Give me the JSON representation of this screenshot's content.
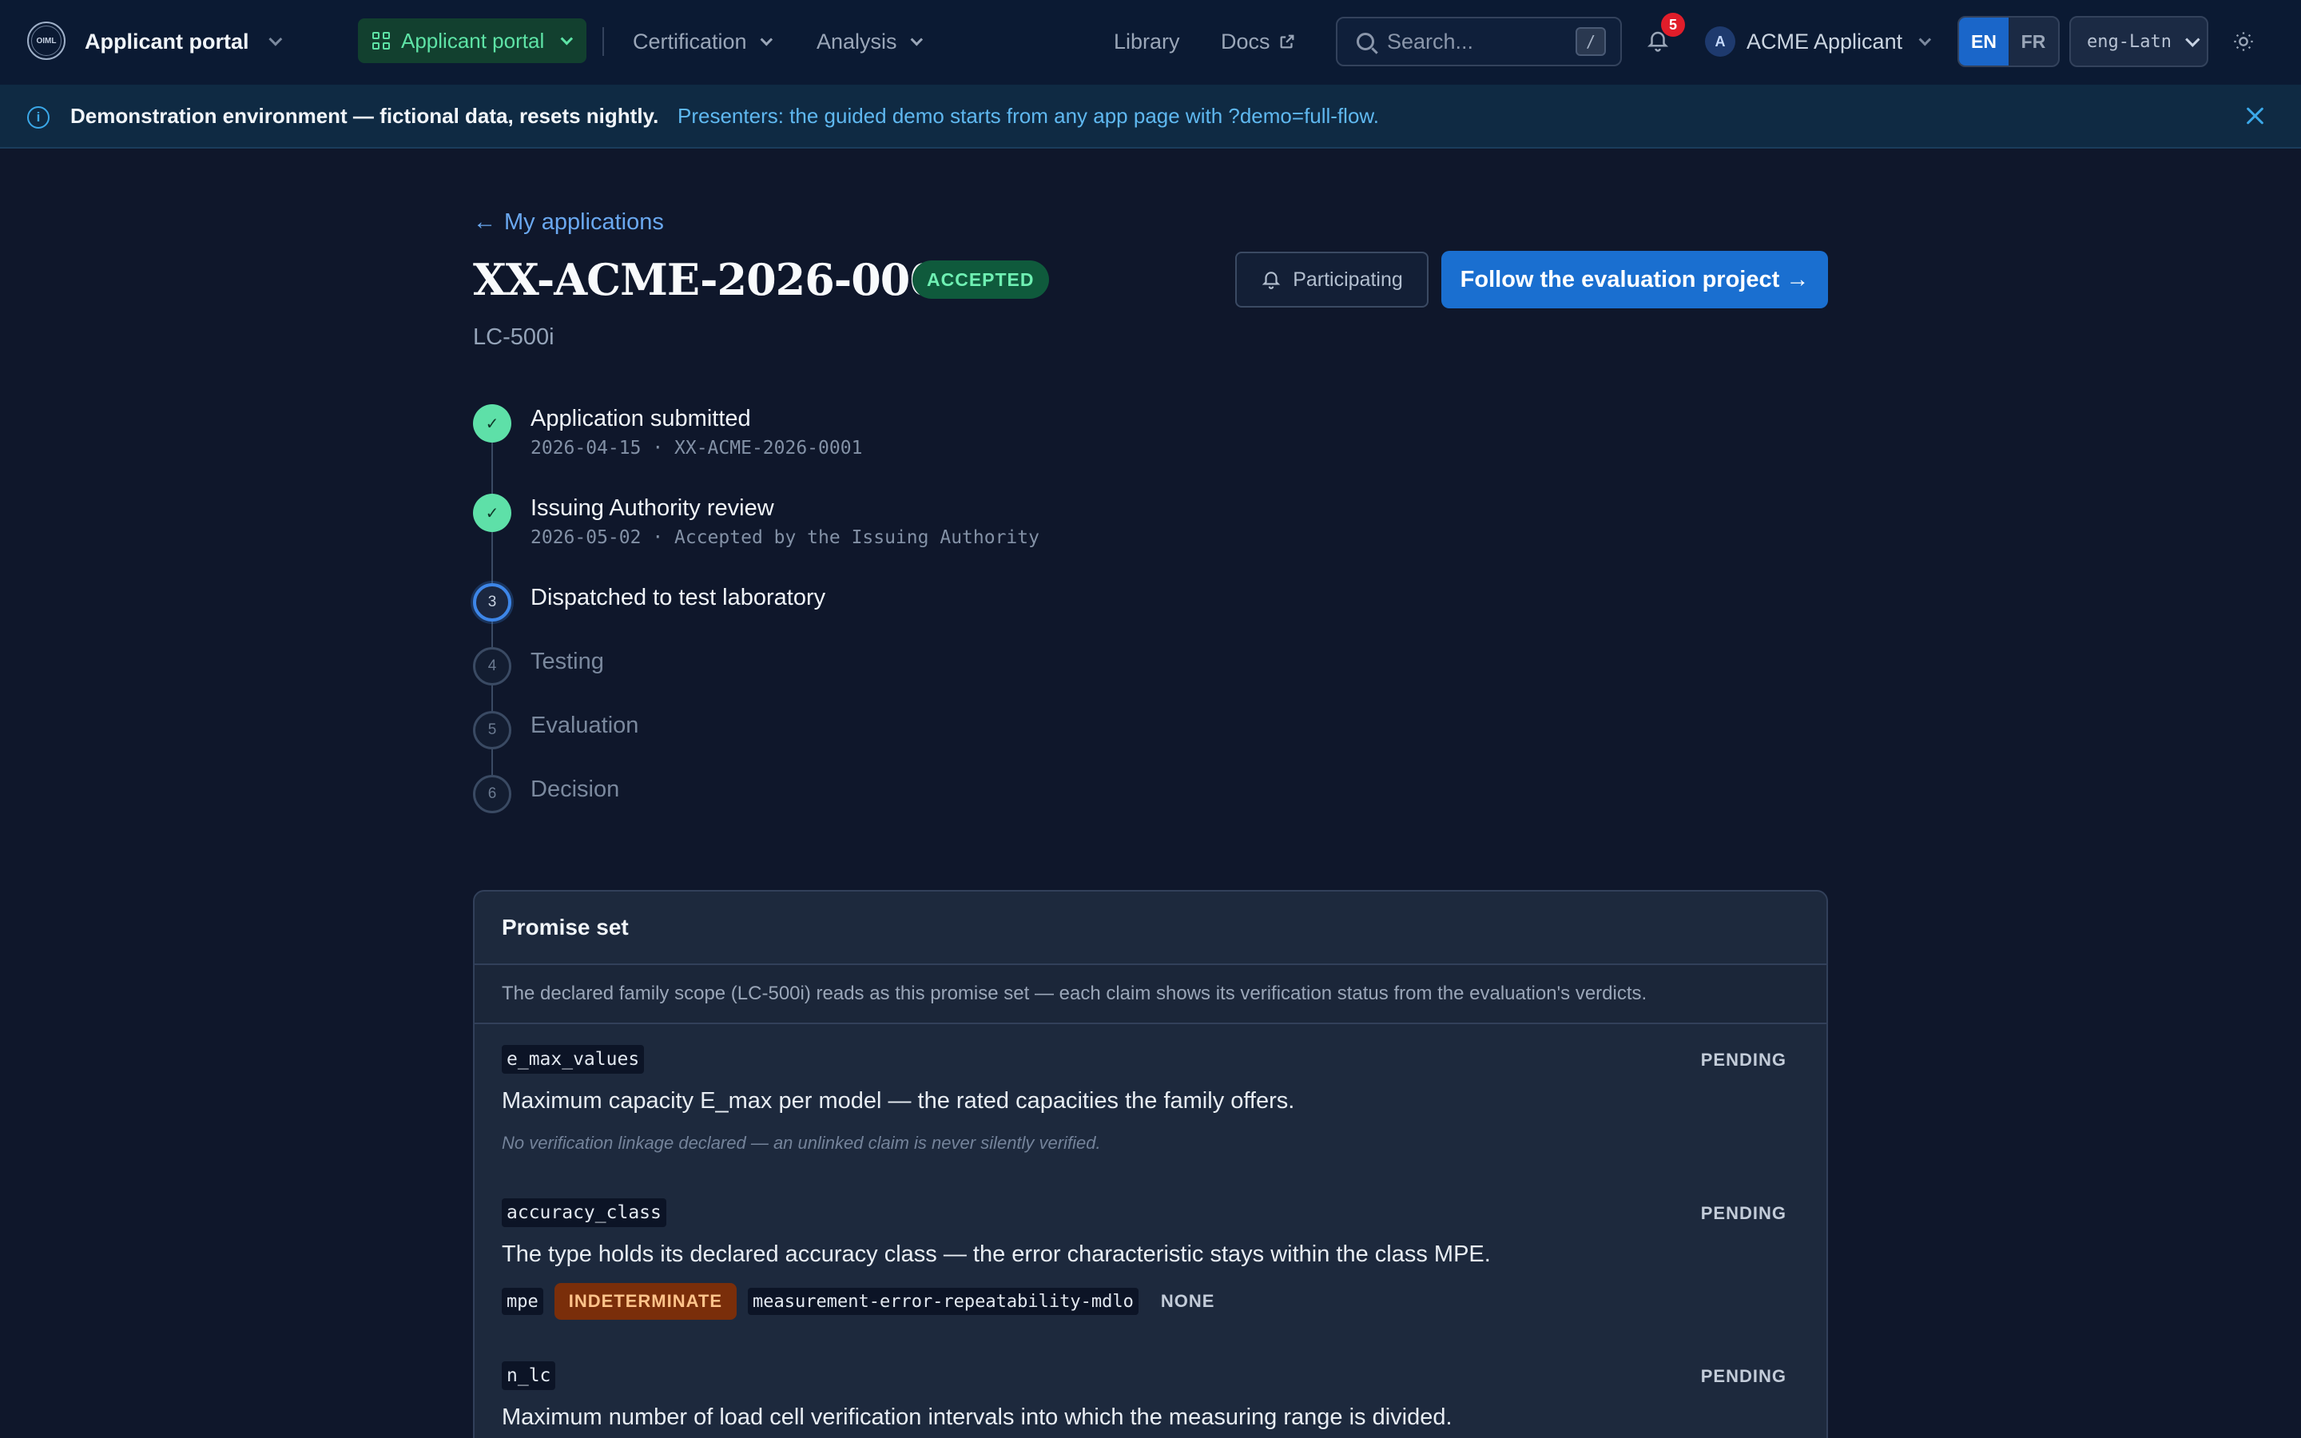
{
  "nav": {
    "logo_text": "OIML",
    "app_name": "Applicant portal",
    "active_item": "Applicant portal",
    "items": [
      "Certification",
      "Analysis"
    ],
    "library": "Library",
    "docs": "Docs",
    "search_placeholder": "Search...",
    "search_shortcut": "/",
    "notification_count": "5",
    "user_initial": "A",
    "user_name": "ACME Applicant",
    "languages": [
      "EN",
      "FR"
    ],
    "active_language": "EN",
    "script_value": "eng-Latn"
  },
  "banner": {
    "strong": "Demonstration environment — fictional data, resets nightly.",
    "link": "Presenters: the guided demo starts from any app page with ?demo=full-flow."
  },
  "header": {
    "back_link": "My applications",
    "title": "XX-ACME-2026-0001",
    "status": "ACCEPTED",
    "subtitle": "LC-500i",
    "participating_label": "Participating",
    "follow_label": "Follow the evaluation project →"
  },
  "timeline": {
    "steps": [
      {
        "marker": "✓",
        "title": "Application submitted",
        "meta": "2026-04-15 · XX-ACME-2026-0001",
        "state": "done"
      },
      {
        "marker": "✓",
        "title": "Issuing Authority review",
        "meta": "2026-05-02 · Accepted by the Issuing Authority",
        "state": "done"
      },
      {
        "marker": "3",
        "title": "Dispatched to test laboratory",
        "meta": "",
        "state": "current"
      },
      {
        "marker": "4",
        "title": "Testing",
        "meta": "",
        "state": "future"
      },
      {
        "marker": "5",
        "title": "Evaluation",
        "meta": "",
        "state": "future"
      },
      {
        "marker": "6",
        "title": "Decision",
        "meta": "",
        "state": "future"
      }
    ]
  },
  "promise_set": {
    "title": "Promise set",
    "intro": "The declared family scope (LC-500i) reads as this promise set — each claim shows its verification status from the evaluation's verdicts.",
    "claims": [
      {
        "key": "e_max_values",
        "status": "PENDING",
        "text": "Maximum capacity E_max per model — the rated capacities the family offers.",
        "note": "No verification linkage declared — an unlinked claim is never silently verified."
      },
      {
        "key": "accuracy_class",
        "status": "PENDING",
        "text": "The type holds its declared accuracy class — the error characteristic stays within the class MPE.",
        "link": {
          "param": "mpe",
          "verdict": "INDETERMINATE",
          "test": "measurement-error-repeatability-mdlo",
          "result": "NONE"
        }
      },
      {
        "key": "n_lc",
        "status": "PENDING",
        "text": "Maximum number of load cell verification intervals into which the measuring range is divided."
      }
    ]
  },
  "colors": {
    "accent": "#1a6fd0",
    "success": "#5ee0a8",
    "warning": "#7a2e0a",
    "background": "#0f172b"
  }
}
